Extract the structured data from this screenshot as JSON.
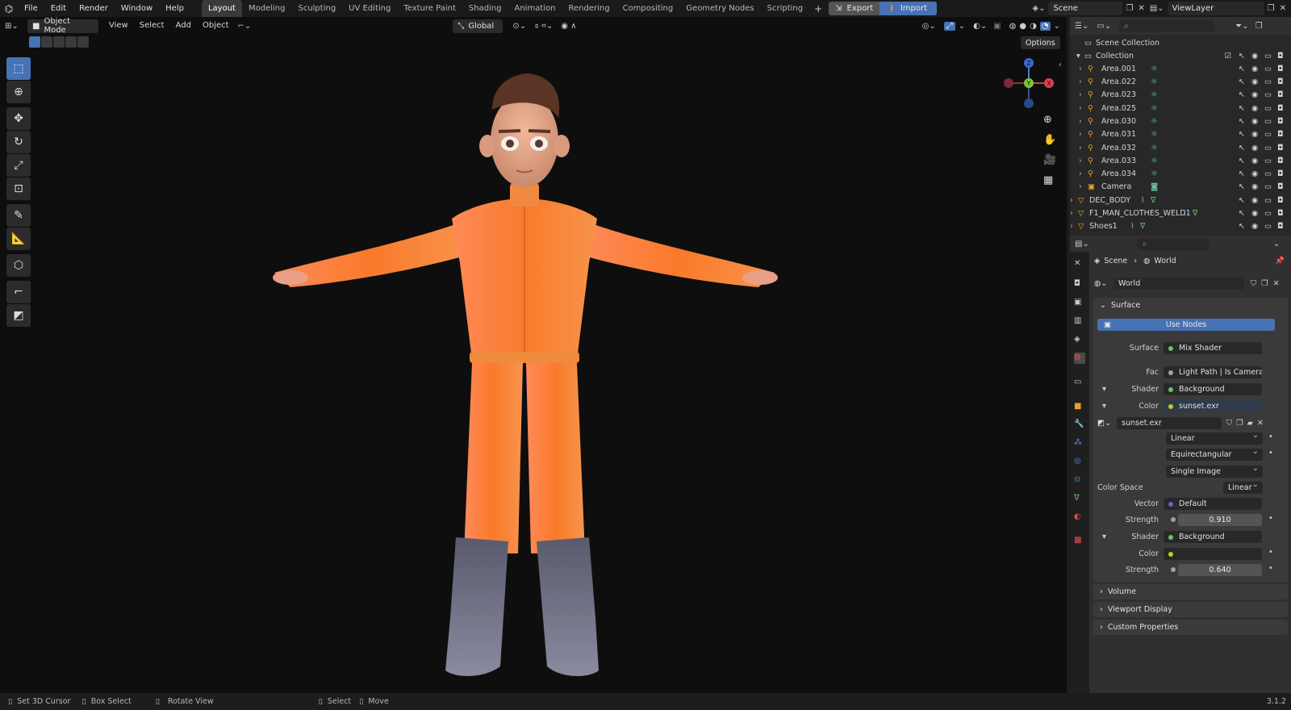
{
  "app": {
    "version": "3.1.2"
  },
  "menu": [
    "File",
    "Edit",
    "Render",
    "Window",
    "Help"
  ],
  "workspaces": [
    "Layout",
    "Modeling",
    "Sculpting",
    "UV Editing",
    "Texture Paint",
    "Shading",
    "Animation",
    "Rendering",
    "Compositing",
    "Geometry Nodes",
    "Scripting"
  ],
  "active_workspace": "Layout",
  "addons": {
    "export": "Export",
    "import": "Import"
  },
  "scene": "Scene",
  "view_layer": "ViewLayer",
  "viewport": {
    "mode": "Object Mode",
    "menus": [
      "View",
      "Select",
      "Add",
      "Object"
    ],
    "transform_orientation": "Global",
    "options": "Options"
  },
  "outliner": {
    "root": "Scene Collection",
    "collection": "Collection",
    "items": [
      {
        "name": "Area.001",
        "type": "light"
      },
      {
        "name": "Area.022",
        "type": "light"
      },
      {
        "name": "Area.023",
        "type": "light"
      },
      {
        "name": "Area.025",
        "type": "light"
      },
      {
        "name": "Area.030",
        "type": "light"
      },
      {
        "name": "Area.031",
        "type": "light"
      },
      {
        "name": "Area.032",
        "type": "light"
      },
      {
        "name": "Area.033",
        "type": "light"
      },
      {
        "name": "Area.034",
        "type": "light"
      },
      {
        "name": "Camera",
        "type": "camera"
      }
    ],
    "objects": [
      "DEC_BODY",
      "F1_MAN_CLOTHES_WELD1",
      "Shoes1"
    ]
  },
  "properties": {
    "breadcrumb": [
      "Scene",
      "World"
    ],
    "world_name": "World",
    "surface_panel": "Surface",
    "use_nodes": "Use Nodes",
    "rows": {
      "surface": {
        "label": "Surface",
        "value": "Mix Shader"
      },
      "fac": {
        "label": "Fac",
        "value": "Light Path | Is Camera ..."
      },
      "shader1": {
        "label": "Shader",
        "value": "Background"
      },
      "color1": {
        "label": "Color",
        "value": "sunset.exr"
      },
      "image": "sunset.exr",
      "interp": "Linear",
      "projection": "Equirectangular",
      "source": "Single Image",
      "colorspace": {
        "label": "Color Space",
        "value": "Linear"
      },
      "vector": {
        "label": "Vector",
        "value": "Default"
      },
      "strength1": {
        "label": "Strength",
        "value": "0.910"
      },
      "shader2": {
        "label": "Shader",
        "value": "Background"
      },
      "color2": {
        "label": "Color",
        "value": ""
      },
      "strength2": {
        "label": "Strength",
        "value": "0.640"
      }
    },
    "collapsed_panels": [
      "Volume",
      "Viewport Display",
      "Custom Properties"
    ]
  },
  "status": {
    "items": [
      "Set 3D Cursor",
      "Box Select",
      "Rotate View",
      "Select",
      "Move"
    ]
  },
  "colors": {
    "accent": "#4772b3",
    "shader_socket": "#63c763",
    "color_socket": "#c7c729",
    "vector_socket": "#6363c7",
    "gray_socket": "#a1a1a1"
  }
}
